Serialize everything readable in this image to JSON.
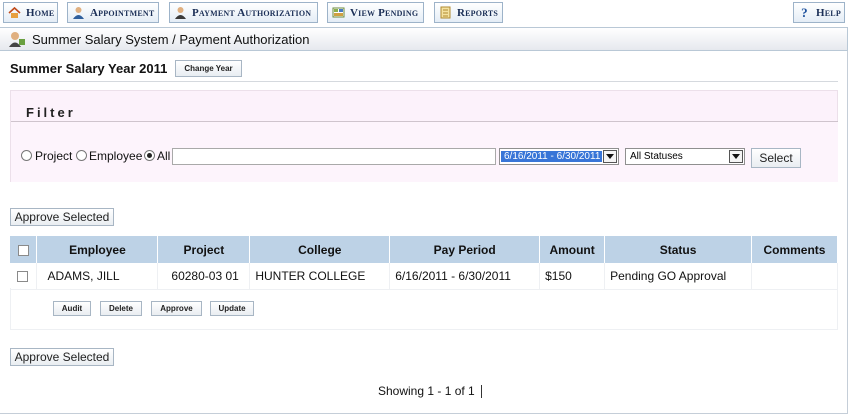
{
  "nav": {
    "home": "Home",
    "appointment": "Appointment",
    "payment_authorization": "Payment Authorization",
    "view_pending": "View Pending",
    "reports": "Reports",
    "help": "Help"
  },
  "breadcrumb": "Summer Salary System / Payment Authorization",
  "year_title": "Summer Salary Year 2011",
  "change_year_label": "Change Year",
  "filter": {
    "legend": "Filter",
    "radio_project": "Project",
    "radio_employee": "Employee",
    "radio_all": "All",
    "selected_radio": "All",
    "search_value": "",
    "period_value": "6/16/2011 - 6/30/2011",
    "status_value": "All Statuses",
    "select_button": "Select"
  },
  "approve_selected_label": "Approve Selected",
  "table": {
    "headers": [
      "Employee",
      "Project",
      "College",
      "Pay Period",
      "Amount",
      "Status",
      "Comments"
    ],
    "rows": [
      {
        "employee": "ADAMS, JILL",
        "project": "60280-03 01",
        "college": "HUNTER COLLEGE",
        "pay_period": "6/16/2011 - 6/30/2011",
        "amount": "$150",
        "status": "Pending GO Approval",
        "comments": ""
      }
    ],
    "row_actions": [
      "Audit",
      "Delete",
      "Approve",
      "Update"
    ]
  },
  "pagination": "Showing 1 - 1 of 1",
  "colors": {
    "header_bg": "#bdd2e6",
    "filter_bg": "#fcf2fb",
    "nav_text": "#1b2f57",
    "selection": "#3875d7"
  },
  "icons": [
    "home-icon",
    "appointment-icon",
    "payment-icon",
    "view-pending-icon",
    "reports-icon",
    "help-icon",
    "user-icon"
  ]
}
